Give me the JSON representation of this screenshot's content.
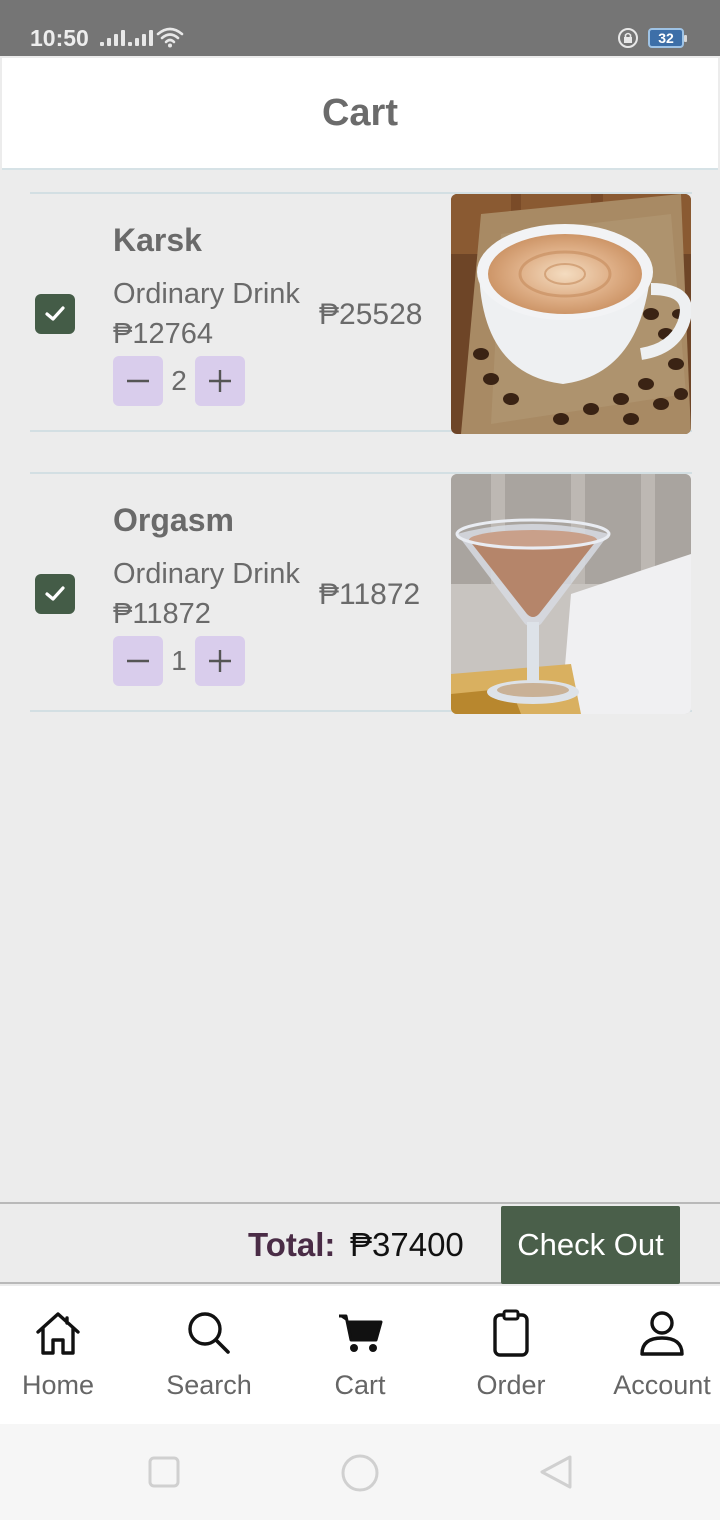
{
  "status": {
    "time": "10:50",
    "battery": "32"
  },
  "header": {
    "title": "Cart"
  },
  "cart": {
    "items": [
      {
        "name": "Karsk",
        "category": "Ordinary Drink",
        "unit_price": "₱12764",
        "line_total": "₱25528",
        "quantity": "2",
        "checked": true,
        "image": "coffee cup with coffee beans"
      },
      {
        "name": "Orgasm",
        "category": "Ordinary Drink",
        "unit_price": "₱11872",
        "line_total": "₱11872",
        "quantity": "1",
        "checked": true,
        "image": "martini glass with creamy drink"
      }
    ]
  },
  "footer": {
    "total_label": "Total:",
    "total_value": "₱37400",
    "checkout_label": "Check Out"
  },
  "nav": {
    "items": [
      {
        "label": "Home",
        "icon": "home-icon"
      },
      {
        "label": "Search",
        "icon": "search-icon"
      },
      {
        "label": "Cart",
        "icon": "cart-icon"
      },
      {
        "label": "Order",
        "icon": "clipboard-icon"
      },
      {
        "label": "Account",
        "icon": "user-icon"
      }
    ]
  },
  "colors": {
    "accent": "#445c47",
    "stepper": "#d9cdec",
    "total_label": "#4a2c46"
  }
}
